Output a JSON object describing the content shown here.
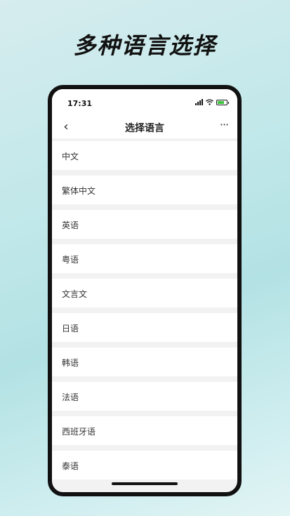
{
  "promo": {
    "title": "多种语言选择"
  },
  "status_bar": {
    "time": "17:31"
  },
  "nav": {
    "back_icon": "‹",
    "title": "选择语言",
    "more_icon": "···"
  },
  "languages": [
    "中文",
    "繁体中文",
    "英语",
    "粤语",
    "文言文",
    "日语",
    "韩语",
    "法语",
    "西班牙语",
    "泰语"
  ]
}
